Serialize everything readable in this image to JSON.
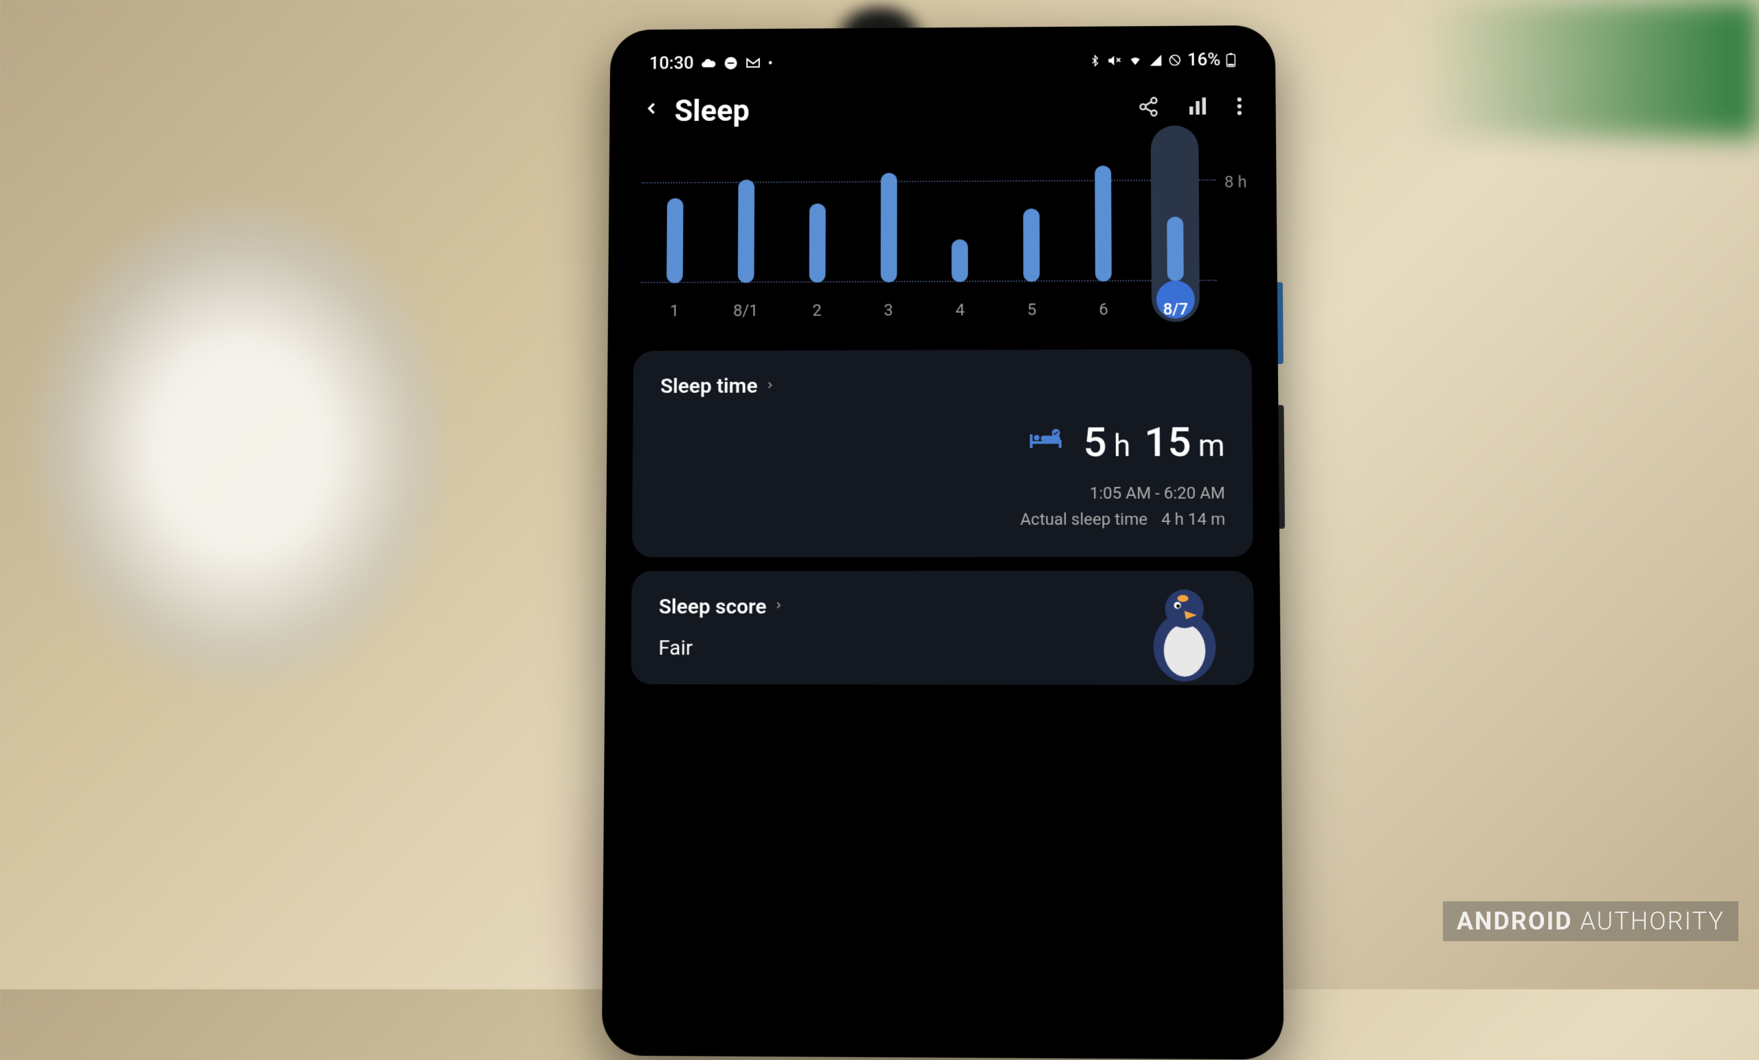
{
  "status_bar": {
    "time": "10:30",
    "battery_percent": "16%"
  },
  "header": {
    "title": "Sleep"
  },
  "chart_data": {
    "type": "bar",
    "title": "",
    "ylabel": "",
    "ylim": [
      0,
      10
    ],
    "reference_label": "8 h",
    "reference_value": 8,
    "categories": [
      "1",
      "8/1",
      "2",
      "3",
      "4",
      "5",
      "6",
      "8/7"
    ],
    "values": [
      7.0,
      8.5,
      6.5,
      9.0,
      3.5,
      6.0,
      9.5,
      5.25
    ],
    "selected_index": 7
  },
  "sleep_time": {
    "card_title": "Sleep time",
    "hours": "5",
    "hours_unit": "h",
    "minutes": "15",
    "minutes_unit": "m",
    "range": "1:05 AM - 6:20 AM",
    "actual_label": "Actual sleep time",
    "actual_value": "4 h 14 m"
  },
  "sleep_score": {
    "card_title": "Sleep score",
    "rating": "Fair"
  },
  "watermark": {
    "brand_bold": "ANDROID",
    "brand_light": "AUTHORITY"
  }
}
